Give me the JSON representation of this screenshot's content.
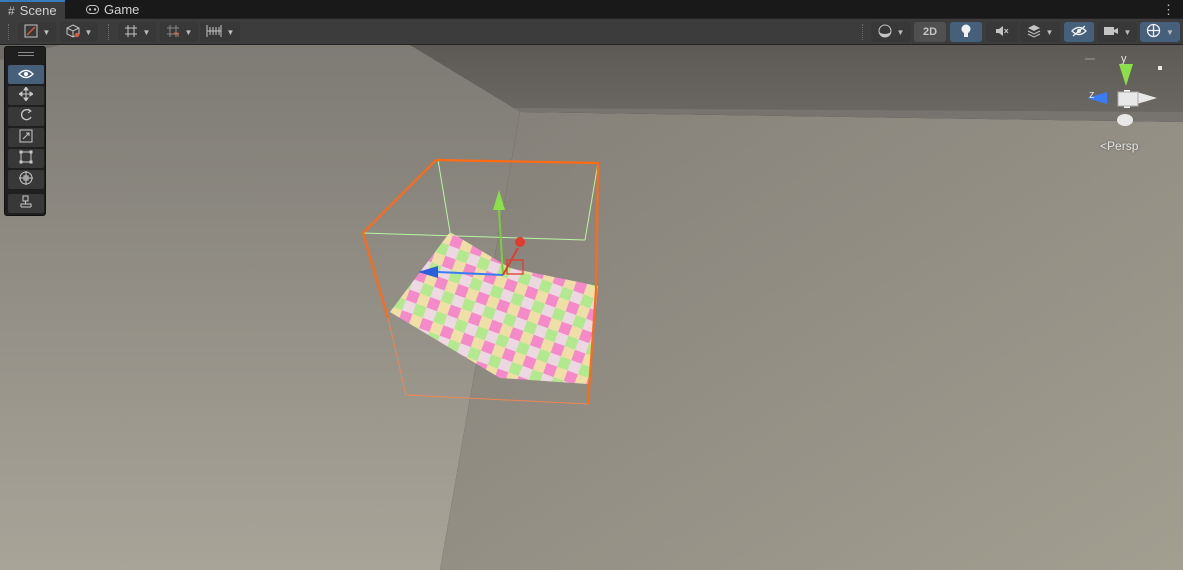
{
  "tabs": [
    {
      "label": "Scene",
      "icon": "grid-icon",
      "active": true
    },
    {
      "label": "Game",
      "icon": "gamepad-icon",
      "active": false
    }
  ],
  "toolbar": {
    "left_buttons": [
      "draw-mode",
      "render-mode",
      "grid",
      "snap",
      "increment-snap"
    ],
    "view_2d_label": "2D",
    "right_buttons": [
      "shading",
      "2d",
      "lighting",
      "audio",
      "effects",
      "hidden-objects",
      "camera",
      "gizmos"
    ]
  },
  "tools": [
    "view-tool",
    "move-tool",
    "rotate-tool",
    "scale-tool",
    "rect-tool",
    "transform-tool",
    "custom-tool"
  ],
  "gizmo": {
    "y_label": "y",
    "z_label": "z",
    "projection_label": "Persp",
    "projection_arrow": "<"
  },
  "colors": {
    "selection_outline": "#ff6a13",
    "accent": "#46607c",
    "axis_x": "#e33b2e",
    "axis_y": "#7ccd3d",
    "axis_z": "#3a7cf5"
  }
}
